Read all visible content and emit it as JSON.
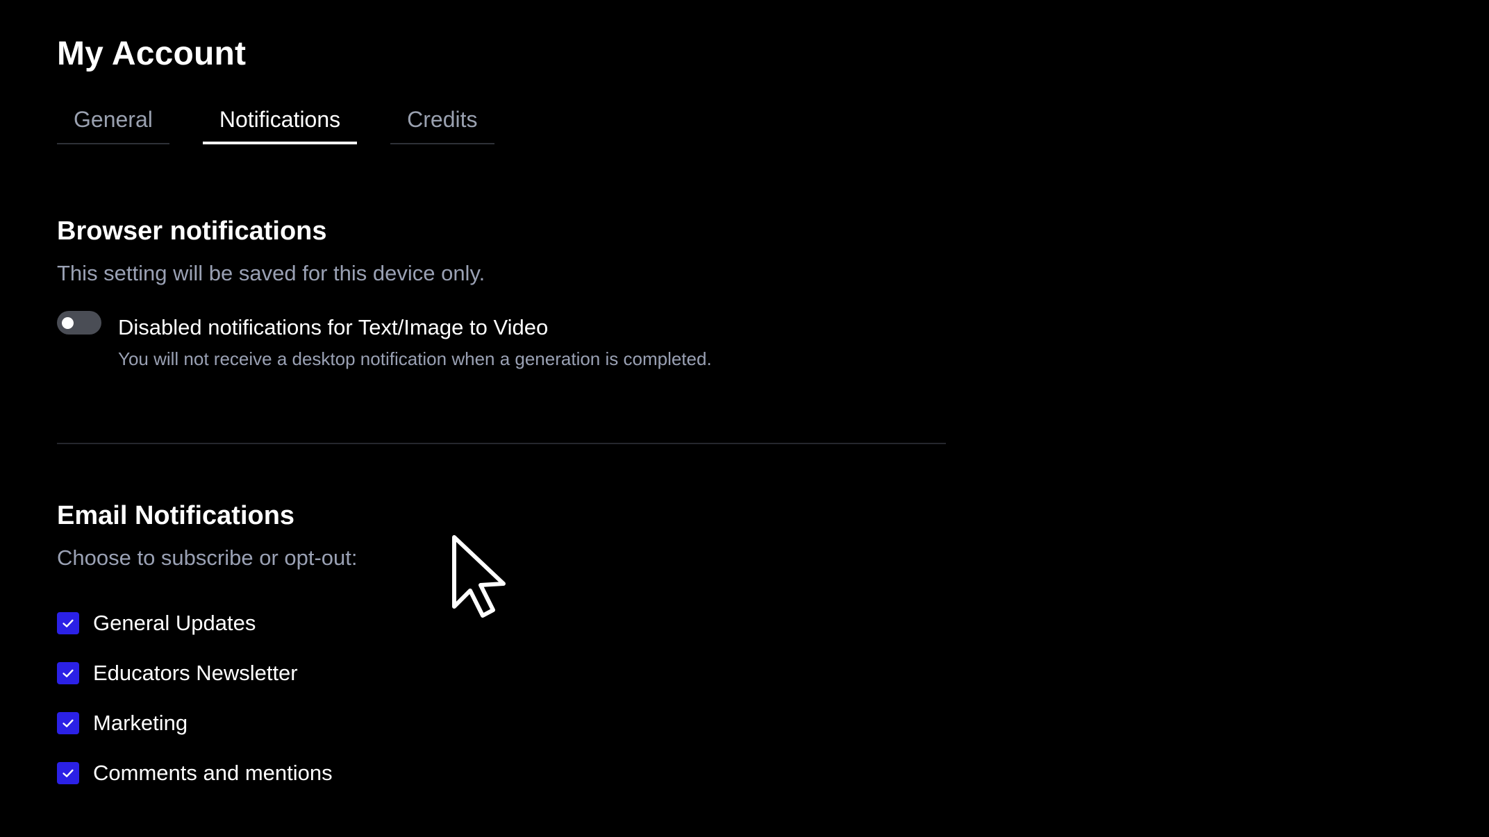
{
  "page": {
    "title": "My Account"
  },
  "tabs": [
    {
      "label": "General",
      "active": false
    },
    {
      "label": "Notifications",
      "active": true
    },
    {
      "label": "Credits",
      "active": false
    }
  ],
  "browser_notifications": {
    "title": "Browser notifications",
    "subtitle": "This setting will be saved for this device only.",
    "toggle": {
      "label": "Disabled notifications for Text/Image to Video",
      "description": "You will not receive a desktop notification when a generation is completed.",
      "on": false
    }
  },
  "email_notifications": {
    "title": "Email Notifications",
    "subtitle": "Choose to subscribe or opt-out:",
    "options": [
      {
        "label": "General Updates",
        "checked": true
      },
      {
        "label": "Educators Newsletter",
        "checked": true
      },
      {
        "label": "Marketing",
        "checked": true
      },
      {
        "label": "Comments and mentions",
        "checked": true
      }
    ]
  },
  "colors": {
    "background": "#000000",
    "checkbox_accent": "#2b21e6",
    "muted_text": "#9aa1b4",
    "toggle_off": "#4a4d55"
  },
  "icons": {
    "checkbox": "check-icon",
    "pointer": "mouse-cursor-icon"
  }
}
